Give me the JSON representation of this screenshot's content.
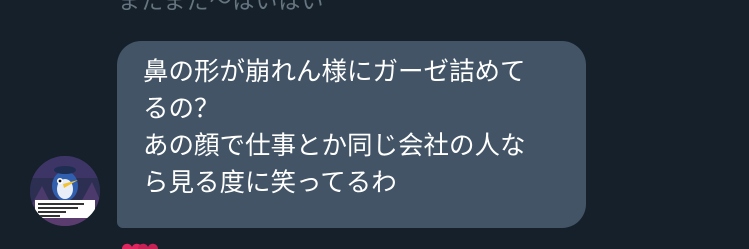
{
  "conversation": {
    "previous_message_fragment": "またまた〜はいはい",
    "message": {
      "lines": [
        "鼻の形が崩れん様にガーゼ詰めて",
        "るの？",
        "あの顔で仕事とか同じ会社の人な",
        "ら見る度に笑ってるわ"
      ]
    },
    "sender_avatar": {
      "icon": "penguin-avatar"
    },
    "reaction": {
      "icon": "heart-icon",
      "color": "#e0245e"
    }
  },
  "colors": {
    "background": "#15202b",
    "bubble": "#425466",
    "text": "#ffffff",
    "muted_text": "#66757f"
  }
}
